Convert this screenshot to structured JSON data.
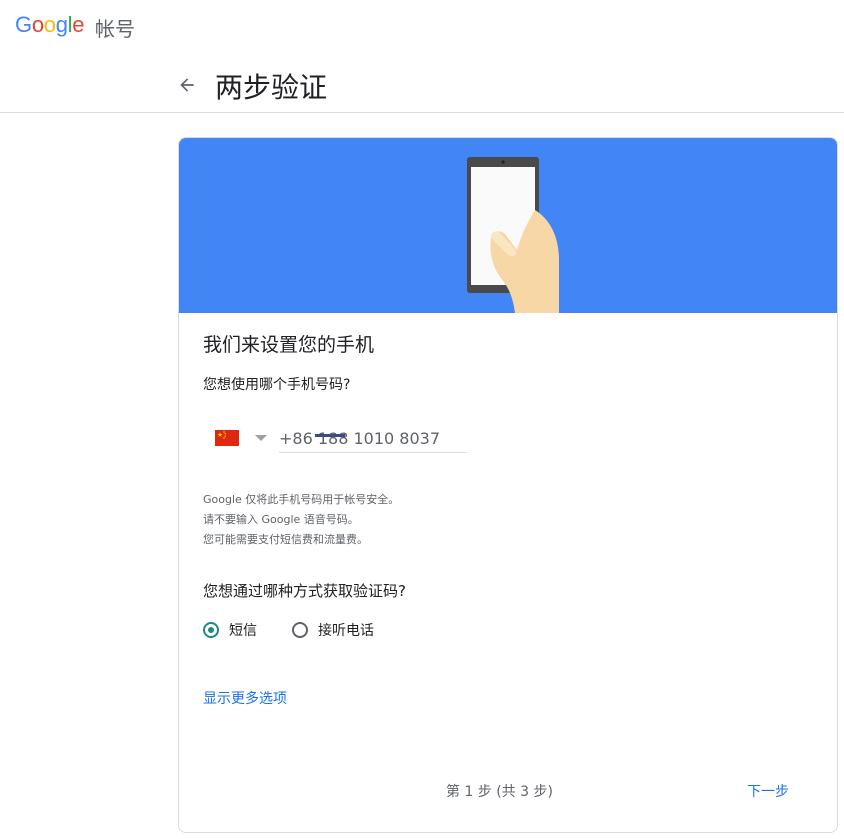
{
  "header": {
    "logo_text": "Google",
    "product_name": "帐号"
  },
  "page": {
    "title": "两步验证",
    "back_icon": "arrow-left-icon"
  },
  "card": {
    "hero_illustration": "hand-holding-phone",
    "hero_color": "#4285f4",
    "title": "我们来设置您的手机",
    "phone_question": "您想使用哪个手机号码?",
    "country_flag": "cn-flag-icon",
    "phone_value": "+86 188 1010 8037",
    "notes": [
      "Google 仅将此手机号码用于帐号安全。",
      "请不要输入 Google 语音号码。",
      "您可能需要支付短信费和流量费。"
    ],
    "method_question": "您想通过哪种方式获取验证码?",
    "methods": [
      {
        "label": "短信",
        "selected": true
      },
      {
        "label": "接听电话",
        "selected": false
      }
    ],
    "more_options": "显示更多选项",
    "step_text": "第 1 步 (共 3 步)",
    "next_label": "下一步"
  },
  "colors": {
    "accent": "#1a73e8",
    "radio_selected": "#1a8a7f"
  }
}
